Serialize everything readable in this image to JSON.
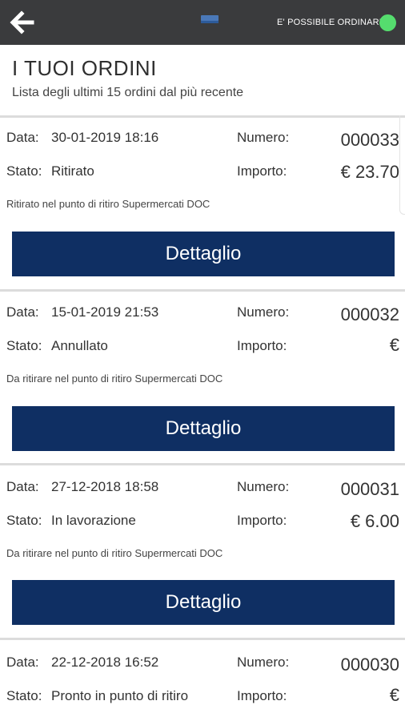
{
  "topbar": {
    "back_icon": "arrow-left-icon",
    "logo_icon": "app-logo-icon",
    "order_status_text": "E' POSSIBILE ORDINARE",
    "status_color": "#55dd6e",
    "background": "#3a3b3d"
  },
  "header": {
    "title": "I TUOI ORDINI",
    "subtitle": "Lista degli ultimi 15 ordini dal più recente"
  },
  "labels": {
    "date": "Data:",
    "number": "Numero:",
    "status": "Stato:",
    "amount": "Importo:"
  },
  "accent": "#0f2f63",
  "orders": [
    {
      "date": "30-01-2019 18:16",
      "number": "000033",
      "status": "Ritirato",
      "amount": "€ 23.70",
      "pickup": "Ritirato nel punto di ritiro Supermercati DOC",
      "button": "Dettaglio"
    },
    {
      "date": "15-01-2019 21:53",
      "number": "000032",
      "status": "Annullato",
      "amount": "€",
      "pickup": "Da ritirare nel punto di ritiro Supermercati DOC",
      "button": "Dettaglio"
    },
    {
      "date": "27-12-2018 18:58",
      "number": "000031",
      "status": "In lavorazione",
      "amount": "€ 6.00",
      "pickup": "Da ritirare nel punto di ritiro Supermercati DOC",
      "button": "Dettaglio"
    },
    {
      "date": "22-12-2018 16:52",
      "number": "000030",
      "status": "Pronto in punto di ritiro",
      "amount": "€",
      "pickup": "",
      "button": ""
    }
  ]
}
